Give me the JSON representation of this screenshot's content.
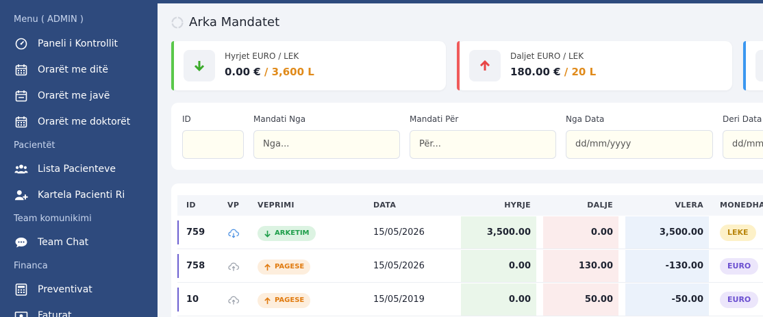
{
  "sidebar": {
    "sections": [
      {
        "title": "Menu ( ADMIN )"
      },
      {
        "title": "Pacientët"
      },
      {
        "title": "Team komunikimi"
      },
      {
        "title": "Financa"
      }
    ],
    "items": [
      {
        "label": "Paneli i Kontrollit",
        "icon": "dashboard-icon"
      },
      {
        "label": "Orarët me ditë",
        "icon": "calendar-icon"
      },
      {
        "label": "Orarët me javë",
        "icon": "calendar-week-icon"
      },
      {
        "label": "Orarët me doktorët",
        "icon": "calendar-icon"
      },
      {
        "label": "Lista Pacienteve",
        "icon": "users-icon"
      },
      {
        "label": "Kartela Pacienti Ri",
        "icon": "user-plus-icon"
      },
      {
        "label": "Team Chat",
        "icon": "chat-icon"
      },
      {
        "label": "Preventivat",
        "icon": "calculator-icon"
      },
      {
        "label": "Faturat",
        "icon": "money-icon"
      }
    ]
  },
  "page": {
    "title": "Arka Mandatet"
  },
  "cards": [
    {
      "label": "Hyrjet EURO / LEK",
      "value_main": "0.00 €",
      "value_alt": " / 3,600 L",
      "accent": "#5ac84a",
      "arrow": "down",
      "arrow_color": "#3aaa2a"
    },
    {
      "label": "Daljet EURO / LEK",
      "value_main": "180.00 €",
      "value_alt": " / 20 L",
      "accent": "#f05a5a",
      "arrow": "up",
      "arrow_color": "#e84545"
    },
    {
      "accent": "#3b97f0"
    }
  ],
  "filters": {
    "id": {
      "label": "ID",
      "placeholder": ""
    },
    "from": {
      "label": "Mandati Nga",
      "placeholder": "Nga..."
    },
    "to": {
      "label": "Mandati Për",
      "placeholder": "Për..."
    },
    "date_from": {
      "label": "Nga Data",
      "placeholder": "dd/mm/yyyy"
    },
    "date_to": {
      "label": "Deri Data",
      "placeholder": "dd/mm/yyyy"
    }
  },
  "table": {
    "headers": {
      "id": "ID",
      "vp": "VP",
      "veprimi": "VEPRIMI",
      "data": "DATA",
      "hyrje": "HYRJE",
      "dalje": "DALJE",
      "vlera": "VLERA",
      "monedha": "MONEDHA"
    },
    "rows": [
      {
        "id": "759",
        "vp": "uploaded",
        "veprimi": "ARKETIM",
        "type": "arketim",
        "data": "15/05/2026",
        "hyrje": "3,500.00",
        "dalje": "0.00",
        "vlera": "3,500.00",
        "monedha": "LEKE"
      },
      {
        "id": "758",
        "vp": "pending",
        "veprimi": "PAGESE",
        "type": "pagese",
        "data": "15/05/2026",
        "hyrje": "0.00",
        "dalje": "130.00",
        "vlera": "-130.00",
        "monedha": "EURO"
      },
      {
        "id": "10",
        "vp": "pending",
        "veprimi": "PAGESE",
        "type": "pagese",
        "data": "15/05/2019",
        "hyrje": "0.00",
        "dalje": "50.00",
        "vlera": "-50.00",
        "monedha": "EURO"
      }
    ]
  }
}
